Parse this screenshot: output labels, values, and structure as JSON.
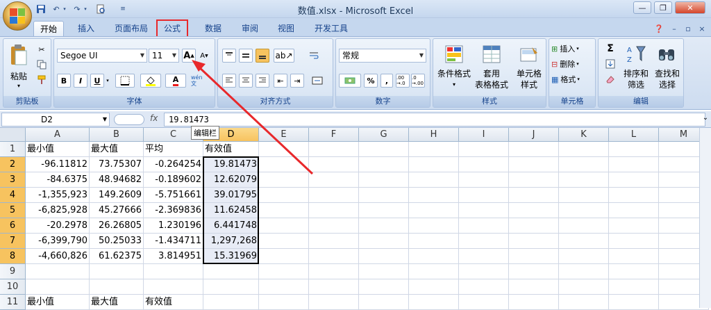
{
  "window": {
    "title": "数值.xlsx - Microsoft Excel"
  },
  "tabs": [
    {
      "id": "home",
      "label": "开始",
      "active": true
    },
    {
      "id": "insert",
      "label": "插入"
    },
    {
      "id": "page-layout",
      "label": "页面布局"
    },
    {
      "id": "formulas",
      "label": "公式",
      "highlighted": true
    },
    {
      "id": "data",
      "label": "数据"
    },
    {
      "id": "review",
      "label": "审阅"
    },
    {
      "id": "view",
      "label": "视图"
    },
    {
      "id": "developer",
      "label": "开发工具"
    }
  ],
  "ribbon": {
    "clipboard": {
      "label": "剪贴板",
      "paste": "粘贴"
    },
    "font": {
      "label": "字体",
      "name": "Segoe UI",
      "size": "11",
      "bold": "B",
      "italic": "I",
      "underline": "U",
      "grow": "A",
      "shrink": "A",
      "color_letter": "A",
      "phonetic": "wén 文"
    },
    "alignment": {
      "label": "对齐方式"
    },
    "number": {
      "label": "数字",
      "format": "常规",
      "percent": "%",
      "comma": ",",
      "inc": ".00 →.0",
      "dec": ".0 →.00"
    },
    "styles": {
      "label": "样式",
      "conditional": "条件格式",
      "table_l1": "套用",
      "table_l2": "表格格式",
      "cell_l1": "单元格",
      "cell_l2": "样式"
    },
    "cells": {
      "label": "单元格",
      "insert": "插入",
      "delete": "删除",
      "format": "格式"
    },
    "editing": {
      "label": "编辑",
      "sum": "Σ",
      "sort_l1": "排序和",
      "sort_l2": "筛选",
      "find_l1": "查找和",
      "find_l2": "选择"
    }
  },
  "formula_bar": {
    "name_box": "D2",
    "fx": "fx",
    "value": "19.81473",
    "tooltip": "编辑栏"
  },
  "grid": {
    "columns": [
      "A",
      "B",
      "C",
      "D",
      "E",
      "F",
      "G",
      "H",
      "I",
      "J",
      "K",
      "L",
      "M"
    ],
    "rows": [
      "1",
      "2",
      "3",
      "4",
      "5",
      "6",
      "7",
      "8",
      "9",
      "10",
      "11"
    ],
    "cells": [
      [
        "最小值",
        "最大值",
        "平均",
        "有效值"
      ],
      [
        "-96.11812",
        "73.75307",
        "-0.264254",
        "19.81473"
      ],
      [
        "-84.6375",
        "48.94682",
        "-0.189602",
        "12.62079"
      ],
      [
        "-1,355,923",
        "149.2609",
        "-5.751661",
        "39.01795"
      ],
      [
        "-6,825,928",
        "45.27666",
        "-2.369836",
        "11.62458"
      ],
      [
        "-20.2978",
        "26.26805",
        "1.230196",
        "6.441748"
      ],
      [
        "-6,399,790",
        "50.25033",
        "-1.434711",
        "1,297,268"
      ],
      [
        "-4,660,826",
        "61.62375",
        "3.814951",
        "15.31969"
      ],
      [
        "",
        "",
        "",
        ""
      ],
      [
        "",
        "",
        "",
        ""
      ],
      [
        "最小值",
        "最大值",
        "有效值",
        ""
      ]
    ]
  },
  "colors": {
    "accent": "#15428b",
    "annotation": "#e8282b",
    "selection": "#f7c35f"
  }
}
